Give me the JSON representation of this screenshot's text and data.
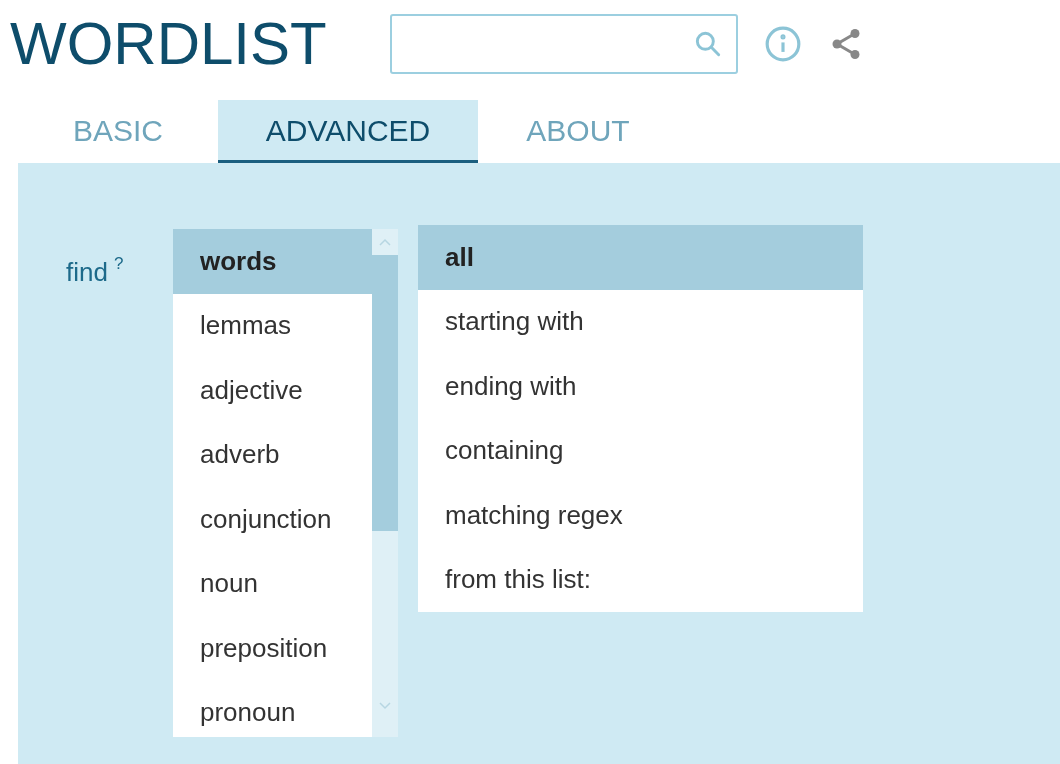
{
  "title": "WORDLIST",
  "tabs": [
    {
      "label": "BASIC",
      "selected": false
    },
    {
      "label": "ADVANCED",
      "selected": true
    },
    {
      "label": "ABOUT",
      "selected": false
    }
  ],
  "find": {
    "label": "find",
    "help": "?"
  },
  "word_types": [
    {
      "label": "words",
      "selected": true
    },
    {
      "label": "lemmas",
      "selected": false
    },
    {
      "label": "adjective",
      "selected": false
    },
    {
      "label": "adverb",
      "selected": false
    },
    {
      "label": "conjunction",
      "selected": false
    },
    {
      "label": "noun",
      "selected": false
    },
    {
      "label": "preposition",
      "selected": false
    },
    {
      "label": "pronoun",
      "selected": false
    }
  ],
  "match_modes": [
    {
      "label": "all",
      "selected": true
    },
    {
      "label": "starting with",
      "selected": false
    },
    {
      "label": "ending with",
      "selected": false
    },
    {
      "label": "containing",
      "selected": false
    },
    {
      "label": "matching regex",
      "selected": false
    },
    {
      "label": "from this list:",
      "selected": false
    }
  ]
}
